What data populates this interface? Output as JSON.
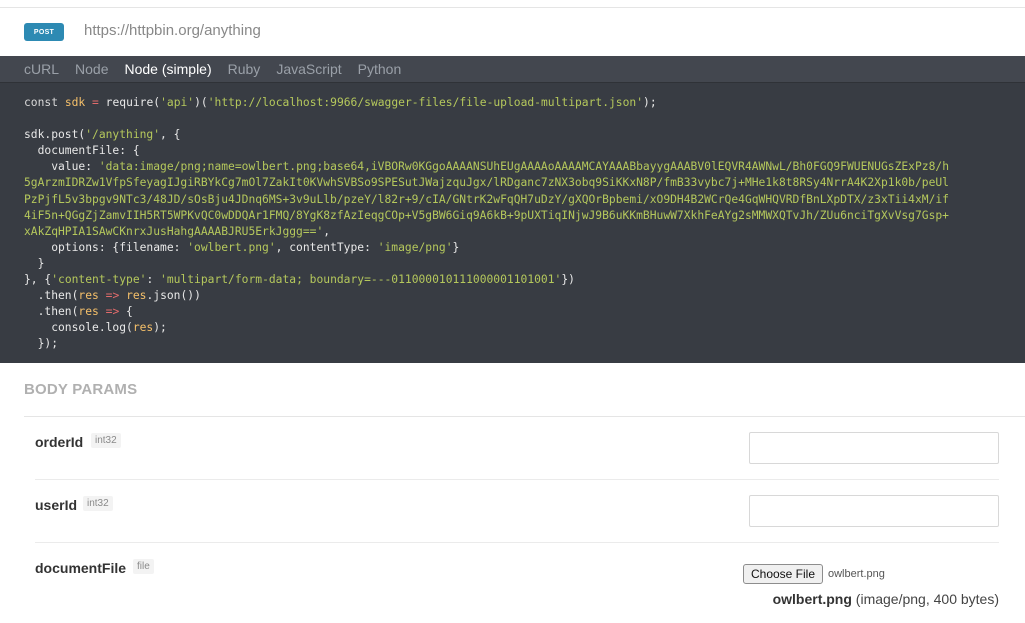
{
  "request": {
    "method": "POST",
    "url": "https://httpbin.org/anything"
  },
  "tabs": [
    {
      "label": "cURL",
      "active": false
    },
    {
      "label": "Node",
      "active": false
    },
    {
      "label": "Node (simple)",
      "active": true
    },
    {
      "label": "Ruby",
      "active": false
    },
    {
      "label": "JavaScript",
      "active": false
    },
    {
      "label": "Python",
      "active": false
    }
  ],
  "code": {
    "line1_const": "const",
    "line1_var": "sdk",
    "line1_eq": "=",
    "line1_require": "require(",
    "line1_api": "'api'",
    "line1_mid": ")(",
    "line1_url": "'http://localhost:9966/swagger-files/file-upload-multipart.json'",
    "line1_end": ");",
    "line3_a": "sdk.post(",
    "line3_path": "'/anything'",
    "line3_b": ", {",
    "line4": "  documentFile: {",
    "line5_a": "    value: ",
    "value_str": "'data:image/png;name=owlbert.png;base64,iVBORw0KGgoAAAANSUhEUgAAAAoAAAAMCAYAAABbayygAAABV0lEQVR4AWNwL/Bh0FGQ9FWUENUGsZExPz8/h\n5gArzmIDRZw1VfpSfeyagIJgiRBYkCg7mOl7ZakIt0KVwhSVBSo9SPESutJWajzquJgx/lRDganc7zNX3obq9SiKKxN8P/fmB33vybc7j+MHe1k8t8RSy4NrrA4K2Xp1k0b/peUl\nPzPjfL5v3bpgv9NTc3/48JD/sOsBju4JDnq6MS+3v9uLlb/pzeY/l82r+9/cIA/GNtrK2wFqQH7uDzY/gXQOrBpbemi/xO9DH4B2WCrQe4GqWHQVRDfBnLXpDTX/z3xTii4xM/if\n4iF5n+QGgZjZamvIIH5RT5WPKvQC0wDDQAr1FMQ/8YgK8zfAzIeqgCOp+V5gBW6Giq9A6kB+9pUXTiqINjwJ9B6uKKmBHuwW7XkhFeAYg2sMMWXQTvJh/ZUu6nciTgXvVsg7Gsp+\nxAkZqHPIA1SAwCKnrxJusHahgAAAABJRU5ErkJggg=='",
    "line5_end": ",",
    "line6_a": "    options: {filename: ",
    "filename_str": "'owlbert.png'",
    "line6_b": ", contentType: ",
    "ctype_str": "'image/png'",
    "line6_end": "}",
    "line7": "  }",
    "line8_a": "}, {",
    "hdr_key": "'content-type'",
    "line8_b": ": ",
    "hdr_val": "'multipart/form-data; boundary=---011000010111000001101001'",
    "line8_end": "})",
    "line9_a": "  .then(",
    "line9_res1": "res",
    "line9_arrow": "=>",
    "line9_res2": "res",
    "line9_b": ".json())",
    "line10_a": "  .then(",
    "line10_res": "res",
    "line10_arrow": "=>",
    "line10_b": " {",
    "line11_a": "    console.log(",
    "line11_res": "res",
    "line11_b": ");",
    "line12": "  });"
  },
  "body_params": {
    "title": "BODY PARAMS",
    "params": [
      {
        "name": "orderId",
        "type": "int32",
        "value": ""
      },
      {
        "name": "userId",
        "type": "int32",
        "value": ""
      },
      {
        "name": "documentFile",
        "type": "file"
      }
    ],
    "file": {
      "button_label": "Choose File",
      "chosen_name": "owlbert.png",
      "info_name": "owlbert.png",
      "info_meta": "(image/png, 400 bytes)"
    }
  }
}
